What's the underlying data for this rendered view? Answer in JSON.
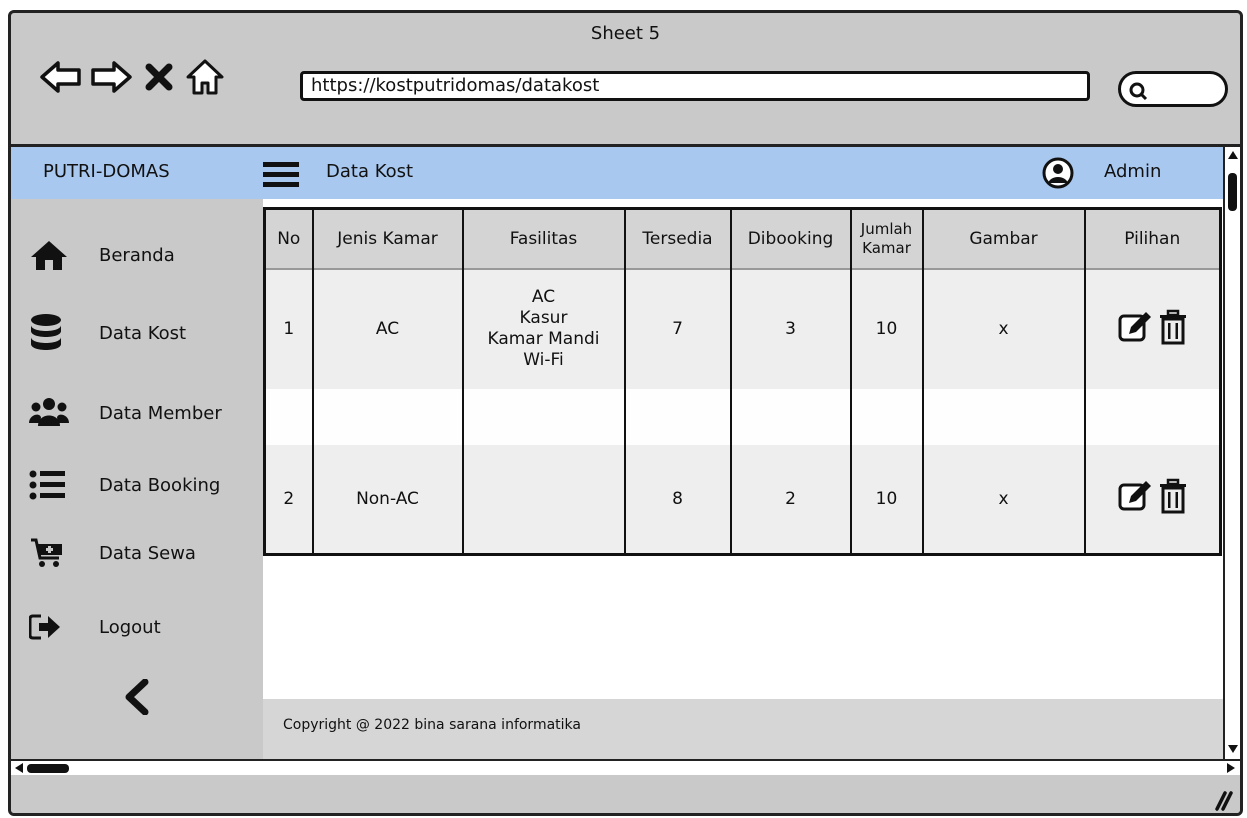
{
  "window": {
    "title": "Sheet 5"
  },
  "browser": {
    "url": "https://kostputridomas/datakost"
  },
  "header": {
    "brand": "PUTRI-DOMAS",
    "page_title": "Data Kost",
    "user": "Admin"
  },
  "sidebar": {
    "items": [
      {
        "label": "Beranda",
        "icon": "home-icon"
      },
      {
        "label": "Data Kost",
        "icon": "database-icon"
      },
      {
        "label": "Data Member",
        "icon": "users-icon"
      },
      {
        "label": "Data Booking",
        "icon": "list-icon"
      },
      {
        "label": "Data Sewa",
        "icon": "cart-icon"
      },
      {
        "label": "Logout",
        "icon": "logout-icon"
      }
    ]
  },
  "table": {
    "headers": [
      "No",
      "Jenis Kamar",
      "Fasilitas",
      "Tersedia",
      "Dibooking",
      "Jumlah Kamar",
      "Gambar",
      "Pilihan"
    ],
    "rows": [
      {
        "no": "1",
        "jenis": "AC",
        "fasilitas": "AC\nKasur\nKamar Mandi\nWi-Fi",
        "tersedia": "7",
        "dibooking": "3",
        "jumlah": "10",
        "gambar": "x"
      },
      {
        "no": "2",
        "jenis": "Non-AC",
        "fasilitas": "",
        "tersedia": "8",
        "dibooking": "2",
        "jumlah": "10",
        "gambar": "x"
      }
    ]
  },
  "footer": {
    "copyright": "Copyright @ 2022 bina sarana informatika"
  },
  "colors": {
    "appbar": "#a9c8f0",
    "chrome": "#c9c9c9"
  }
}
